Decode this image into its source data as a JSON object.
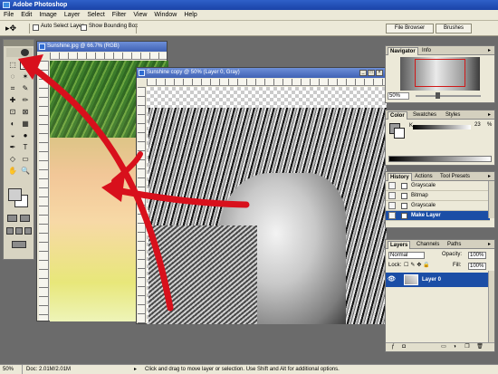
{
  "app": {
    "title": "Adobe Photoshop"
  },
  "menu": [
    "File",
    "Edit",
    "Image",
    "Layer",
    "Select",
    "Filter",
    "View",
    "Window",
    "Help"
  ],
  "options": {
    "tool_glyph": "▸✥",
    "auto_select": "Auto Select Layer",
    "show_bounding": "Show Bounding Box",
    "file_browser": "File Browser",
    "brushes": "Brushes"
  },
  "toolbox": {
    "tools": [
      "⬚",
      "➤",
      "◌",
      "✶",
      "⌗",
      "✎",
      "✚",
      "✏",
      "⊡",
      "⊠",
      "◐",
      "▦",
      "◒",
      "●",
      "✒",
      "T",
      "◇",
      "▭",
      "✋",
      "🔍"
    ]
  },
  "documents": [
    {
      "title": "Sunshine.jpg @ 66.7% (RGB)"
    },
    {
      "title": "Sunshine copy @ 50% (Layer 0, Gray)"
    }
  ],
  "navigator": {
    "tabs": [
      "Navigator",
      "Info"
    ],
    "zoom": "50%"
  },
  "color": {
    "tabs": [
      "Color",
      "Swatches",
      "Styles"
    ],
    "channel": "K",
    "value": "23",
    "unit": "%"
  },
  "history": {
    "tabs": [
      "History",
      "Actions",
      "Tool Presets"
    ],
    "items": [
      {
        "label": "Grayscale",
        "active": false
      },
      {
        "label": "Bitmap",
        "active": false
      },
      {
        "label": "Grayscale",
        "active": false
      },
      {
        "label": "Make Layer",
        "active": true
      }
    ]
  },
  "layers": {
    "tabs": [
      "Layers",
      "Channels",
      "Paths"
    ],
    "blend_mode": "Normal",
    "opacity_label": "Opacity:",
    "opacity": "100%",
    "lock_label": "Lock:",
    "fill_label": "Fill:",
    "fill": "100%",
    "layer_name": "Layer 0"
  },
  "status": {
    "zoom": "50%",
    "doc": "Doc: 2.01M/2.01M",
    "hint": "Click and drag to move layer or selection.  Use Shift and Alt for additional options."
  },
  "colors": {
    "title_bar": "#2f60c8",
    "annotation_arrow": "#d8101c",
    "selection": "#1b4ea6"
  }
}
